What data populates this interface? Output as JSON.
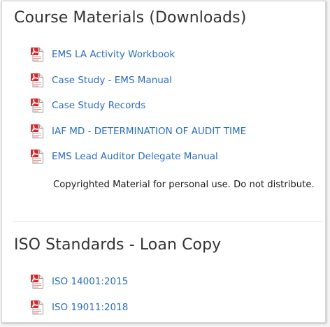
{
  "course_materials": {
    "title": "Course Materials (Downloads)",
    "items": [
      {
        "label": "EMS LA Activity Workbook",
        "icon": "pdf-icon"
      },
      {
        "label": "Case Study - EMS Manual",
        "icon": "pdf-icon"
      },
      {
        "label": "Case Study Records",
        "icon": "pdf-icon"
      },
      {
        "label": "IAF MD - DETERMINATION OF AUDIT TIME",
        "icon": "pdf-icon"
      },
      {
        "label": "EMS Lead Auditor Delegate Manual",
        "icon": "pdf-icon"
      }
    ],
    "notice": "Copyrighted Material for personal use. Do not distribute."
  },
  "iso_standards": {
    "title": "ISO Standards - Loan Copy",
    "items": [
      {
        "label": "ISO 14001:2015",
        "icon": "pdf-icon"
      },
      {
        "label": "ISO 19011:2018",
        "icon": "pdf-icon"
      }
    ]
  },
  "colors": {
    "link": "#2a6ebb",
    "heading": "#333333",
    "pdf_red": "#d22b2b"
  }
}
